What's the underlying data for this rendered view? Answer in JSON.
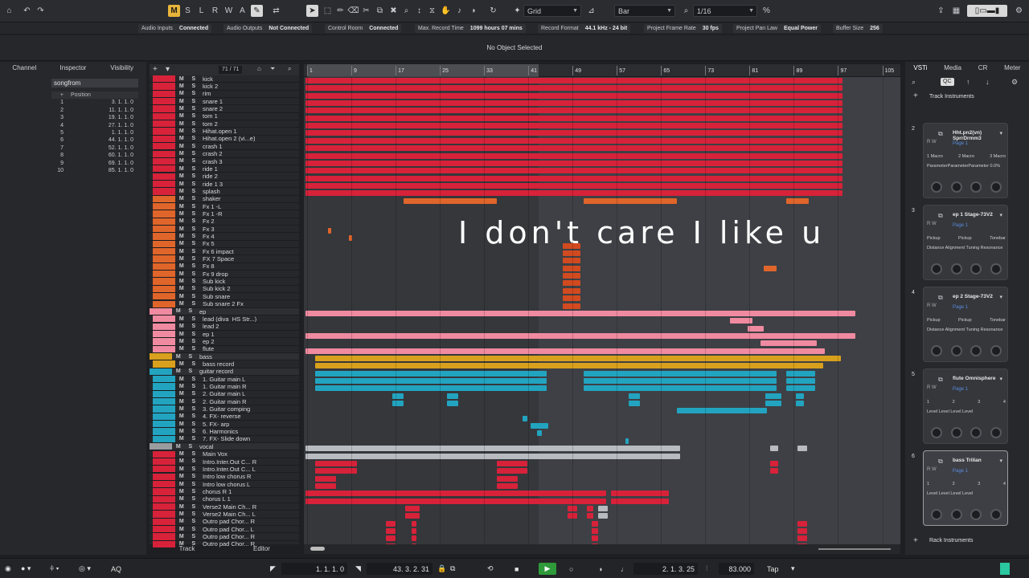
{
  "toolbar": {
    "mode_buttons": [
      "M",
      "S",
      "L",
      "R",
      "W",
      "A"
    ],
    "snap_type": "Grid",
    "grid_type": "Bar",
    "quantize": "1/16"
  },
  "status": [
    {
      "label": "Audio Inputs",
      "value": "Connected"
    },
    {
      "label": "Audio Outputs",
      "value": "Not Connected"
    },
    {
      "label": "Control Room",
      "value": "Connected"
    },
    {
      "label": "Max. Record Time",
      "value": "1099 hours 07 mins"
    },
    {
      "label": "Record Format",
      "value": "44.1 kHz - 24 bit"
    },
    {
      "label": "Project Frame Rate",
      "value": "30 fps"
    },
    {
      "label": "Project Pan Law",
      "value": "Equal Power"
    },
    {
      "label": "Buffer Size",
      "value": "256"
    }
  ],
  "info_line": "No Object Selected",
  "inspector": {
    "tabs": [
      "Channel",
      "Inspector",
      "Visibility"
    ],
    "marker_track": "songfrom",
    "position_header": "Position",
    "markers": [
      {
        "i": "1",
        "pos": "3. 1. 1. 0"
      },
      {
        "i": "2",
        "pos": "11. 1. 1. 0"
      },
      {
        "i": "3",
        "pos": "19. 1. 1. 0"
      },
      {
        "i": "4",
        "pos": "27. 1. 1. 0"
      },
      {
        "i": "5",
        "pos": "1. 1. 1. 0"
      },
      {
        "i": "6",
        "pos": "44. 1. 1. 0"
      },
      {
        "i": "7",
        "pos": "52. 1. 1. 0"
      },
      {
        "i": "8",
        "pos": "60. 1. 1. 0"
      },
      {
        "i": "9",
        "pos": "69. 1. 1. 0"
      },
      {
        "i": "10",
        "pos": "85. 1. 1. 0"
      }
    ]
  },
  "tracklist": {
    "count": "71 / 71",
    "tracks": [
      {
        "name": "kick",
        "color": "#d7223a"
      },
      {
        "name": "kick 2",
        "color": "#d7223a"
      },
      {
        "name": "rim",
        "color": "#d7223a"
      },
      {
        "name": "snare 1",
        "color": "#d7223a"
      },
      {
        "name": "snare 2",
        "color": "#d7223a"
      },
      {
        "name": "tom 1",
        "color": "#d7223a"
      },
      {
        "name": "tom 2",
        "color": "#d7223a"
      },
      {
        "name": "Hihat.open 1",
        "color": "#d7223a"
      },
      {
        "name": "Hihat.open 2 (vi...e)",
        "color": "#d7223a"
      },
      {
        "name": "crash 1",
        "color": "#d7223a"
      },
      {
        "name": "crash 2",
        "color": "#d7223a"
      },
      {
        "name": "crash 3",
        "color": "#d7223a"
      },
      {
        "name": "ride 1",
        "color": "#d7223a"
      },
      {
        "name": "ride 2",
        "color": "#d7223a"
      },
      {
        "name": "ride 1 3",
        "color": "#d7223a"
      },
      {
        "name": "splash",
        "color": "#d7223a"
      },
      {
        "name": "shaker",
        "color": "#e0652a"
      },
      {
        "name": "Fx 1 -L",
        "color": "#e0652a"
      },
      {
        "name": "Fx 1 -R",
        "color": "#e0652a"
      },
      {
        "name": "Fx 2",
        "color": "#e0652a"
      },
      {
        "name": "Fx 3",
        "color": "#e0652a"
      },
      {
        "name": "Fx 4",
        "color": "#e0652a"
      },
      {
        "name": "Fx 5",
        "color": "#e0652a"
      },
      {
        "name": "Fx 6 impact",
        "color": "#e0652a"
      },
      {
        "name": "FX 7 Space",
        "color": "#e0652a"
      },
      {
        "name": "Fx 8",
        "color": "#e0652a"
      },
      {
        "name": "Fx 9 drop",
        "color": "#e0652a"
      },
      {
        "name": "Sub kick",
        "color": "#e0652a"
      },
      {
        "name": "Sub kick 2",
        "color": "#e0652a"
      },
      {
        "name": "Sub snare",
        "color": "#e0652a"
      },
      {
        "name": "Sub snare 2 Fx",
        "color": "#e0652a"
      },
      {
        "name": "ep",
        "color": "#f08aa0",
        "folder": true
      },
      {
        "name": "lead (diva_HS Str...)",
        "color": "#f08aa0"
      },
      {
        "name": "lead 2",
        "color": "#f08aa0"
      },
      {
        "name": "ep 1",
        "color": "#f08aa0"
      },
      {
        "name": "ep 2",
        "color": "#f08aa0"
      },
      {
        "name": "flute",
        "color": "#f08aa0"
      },
      {
        "name": "bass",
        "color": "#d8a01c",
        "folder": true
      },
      {
        "name": "bass record",
        "color": "#d8a01c"
      },
      {
        "name": "guitar record",
        "color": "#22a4c0",
        "folder": true
      },
      {
        "name": "1. Guitar main L",
        "color": "#22a4c0"
      },
      {
        "name": "1. Guitar main R",
        "color": "#22a4c0"
      },
      {
        "name": "2. Guitar main L",
        "color": "#22a4c0"
      },
      {
        "name": "2. Guitar main R",
        "color": "#22a4c0"
      },
      {
        "name": "3. Guitar comping",
        "color": "#22a4c0"
      },
      {
        "name": "4. FX- reverse",
        "color": "#22a4c0"
      },
      {
        "name": "5. FX- arp",
        "color": "#22a4c0"
      },
      {
        "name": "6. Harmonics",
        "color": "#22a4c0"
      },
      {
        "name": "7. FX- Slide down",
        "color": "#22a4c0"
      },
      {
        "name": "vocal",
        "color": "#9a9ca0",
        "folder": true
      },
      {
        "name": "Main Vox",
        "color": "#d7223a"
      },
      {
        "name": "Intro.Inter.Out C... R",
        "color": "#d7223a"
      },
      {
        "name": "Intro.Inter.Out C... L",
        "color": "#d7223a"
      },
      {
        "name": "Intro low chorus R",
        "color": "#d7223a"
      },
      {
        "name": "Intro low chorus L",
        "color": "#d7223a"
      },
      {
        "name": "chorus R 1",
        "color": "#d7223a"
      },
      {
        "name": "chorus L 1",
        "color": "#d7223a"
      },
      {
        "name": "Verse2 Main Ch... R",
        "color": "#d7223a"
      },
      {
        "name": "Verse2 Main Ch... L",
        "color": "#d7223a"
      },
      {
        "name": "Outro pad Chor... R",
        "color": "#d7223a"
      },
      {
        "name": "Outro pad Chor... L",
        "color": "#d7223a"
      },
      {
        "name": "Outro pad Chor... R",
        "color": "#d7223a"
      },
      {
        "name": "Outro pad Chor... R",
        "color": "#d7223a"
      }
    ]
  },
  "ruler": [
    "1",
    "9",
    "17",
    "25",
    "33",
    "41",
    "49",
    "57",
    "65",
    "73",
    "81",
    "89",
    "97",
    "105"
  ],
  "lyric_overlay": "I don't care I like u",
  "right_panel": {
    "tabs": [
      "VSTi",
      "Media",
      "CR",
      "Meter"
    ],
    "header": "Track Instruments",
    "footer": "Rack Instruments",
    "qc": "QC",
    "slots": [
      {
        "num": "2",
        "name": "Hht.pn2(vn) SprrDrmm3",
        "page": "Page 1",
        "params": [
          "1 Macro",
          "2 Macro",
          "3 Macro"
        ],
        "extra": "ParameterParameterParameter 0.0%"
      },
      {
        "num": "3",
        "name": "ep 1 Stage-73V2",
        "page": "Page 1",
        "params": [
          "Pickup",
          "Pickup",
          "Tonebar"
        ],
        "extra": "Distance Alignment Tuning Resonance"
      },
      {
        "num": "4",
        "name": "ep 2 Stage-73V2",
        "page": "Page 1",
        "params": [
          "Pickup",
          "Pickup",
          "Tonebar"
        ],
        "extra": "Distance Alignment Tuning Resonance"
      },
      {
        "num": "5",
        "name": "flute Omnisphere",
        "page": "Page 1",
        "params": [
          "1",
          "2",
          "3",
          "4"
        ],
        "extra": "Level Level Level Level"
      },
      {
        "num": "6",
        "name": "bass Trilian",
        "page": "Page 1",
        "params": [
          "1",
          "2",
          "3",
          "4"
        ],
        "extra": "Level Level Level Level"
      }
    ]
  },
  "bottom_tabs": [
    "Track",
    "Editor"
  ],
  "transport": {
    "left_locator": "1. 1. 1. 0",
    "right_locator": "43. 3. 2. 31",
    "position": "2. 1. 3. 25",
    "tempo": "83.000",
    "tap": "Tap",
    "aq": "AQ"
  },
  "colors": {
    "accent": "#e8b53a",
    "drums": "#d7223a",
    "fx": "#e0652a",
    "keys": "#f08aa0",
    "bass": "#d8a01c",
    "guitar": "#22a4c0",
    "vocal": "#d7223a",
    "play": "#2e9a3a"
  }
}
